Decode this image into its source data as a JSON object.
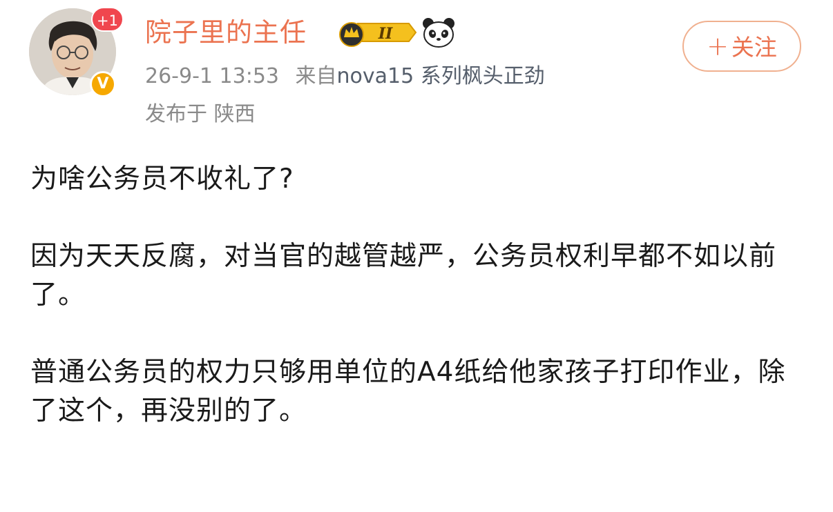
{
  "author": {
    "name": "院子里的主任",
    "plus_badge": "+1",
    "verified_mark": "V",
    "vip_level": "II",
    "icons": [
      "avatar-portrait",
      "crown-vip-icon",
      "panda-icon",
      "verified-icon"
    ]
  },
  "meta": {
    "timestamp": "26-9-1 13:53",
    "source_prefix": "来自",
    "source_device": "nova15 系列枫头正劲",
    "location": "发布于 陕西"
  },
  "actions": {
    "follow_plus": "+",
    "follow_label": "关注"
  },
  "colors": {
    "username": "#eb7350",
    "meta": "#8a8a8a",
    "follow_border": "#f0b08f",
    "plus_badge": "#f0464e",
    "verified_badge": "#f6a800",
    "vip_gold": "#f4c01e"
  },
  "post": {
    "paragraphs": [
      "为啥公务员不收礼了?",
      "因为天天反腐，对当官的越管越严，公务员权利早都不如以前了。",
      "普通公务员的权力只够用单位的A4纸给他家孩子打印作业，除了这个，再没别的了。"
    ]
  }
}
